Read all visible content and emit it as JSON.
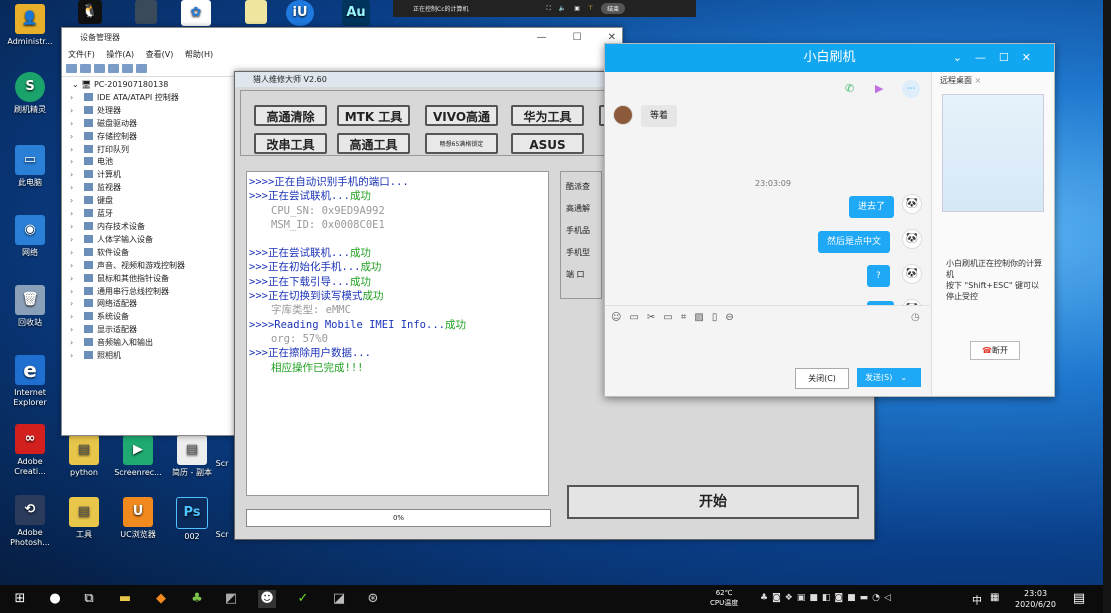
{
  "remote_bar": {
    "title": "正在控制Cc的计算机",
    "end_label": "结束"
  },
  "desktop_icons": [
    {
      "label": "Administr...",
      "color": "#e8b02a",
      "glyph": "👤"
    },
    {
      "label": "刷机精灵",
      "color": "#1aa36b",
      "glyph": "S"
    },
    {
      "label": "此电脑",
      "color": "#2a7fd6",
      "glyph": "▭"
    },
    {
      "label": "网络",
      "color": "#2a7fd6",
      "glyph": "◉"
    },
    {
      "label": "回收站",
      "color": "#8aa0b8",
      "glyph": "🗑"
    },
    {
      "label": "Internet Explorer",
      "color": "#1f6fd1",
      "glyph": "e"
    },
    {
      "label": "Adobe Creati...",
      "color": "#d3201f",
      "glyph": "∞"
    },
    {
      "label": "Adobe Photosh...",
      "color": "#2b3b5c",
      "glyph": "⟲"
    },
    {
      "label": "python",
      "color": "#e8c64a",
      "glyph": "▤"
    },
    {
      "label": "Screenrec...",
      "color": "#1eaa70",
      "glyph": "▶"
    },
    {
      "label": "简历 - 副本",
      "color": "#eeeeee",
      "glyph": "▤"
    },
    {
      "label": "工具",
      "color": "#e8c64a",
      "glyph": "▤"
    },
    {
      "label": "UC浏览器",
      "color": "#f08a1e",
      "glyph": "U"
    },
    {
      "label": "002",
      "color": "#0a2b5c",
      "glyph": "Ps"
    },
    {
      "label": "Scr",
      "color": "#444",
      "glyph": ""
    },
    {
      "label": "Scr",
      "color": "#444",
      "glyph": ""
    }
  ],
  "top_icons": [
    {
      "glyph": "Au",
      "color": "#00355e"
    },
    {
      "glyph": "iU",
      "color": "#1f7ae0"
    }
  ],
  "device_manager": {
    "title": "设备管理器",
    "menu": [
      "文件(F)",
      "操作(A)",
      "查看(V)",
      "帮助(H)"
    ],
    "root": "PC-201907180138",
    "items": [
      "IDE ATA/ATAPI 控制器",
      "处理器",
      "磁盘驱动器",
      "存储控制器",
      "打印队列",
      "电池",
      "计算机",
      "监视器",
      "键盘",
      "蓝牙",
      "内存技术设备",
      "人体学输入设备",
      "软件设备",
      "声音、视频和游戏控制器",
      "鼠标和其他指针设备",
      "通用串行总线控制器",
      "网络适配器",
      "系统设备",
      "显示适配器",
      "音频输入和输出",
      "照相机"
    ]
  },
  "repair_tool": {
    "title": "猎人维修大师 V2.60",
    "buttons": [
      "高通清除",
      "MTK 工具",
      "VIVO高通",
      "华为工具",
      "改串工具",
      "高通工具",
      "畅想65满格锁定",
      "ASUS"
    ],
    "log": [
      {
        "text": ">>>>正在自动识别手机的端口...",
        "style": "b"
      },
      {
        "text": ">>>正在尝试联机...",
        "style": "b",
        "extra": "成功"
      },
      {
        "text": "CPU_SN:  0x9ED9A992",
        "style": "gr"
      },
      {
        "text": "MSM_ID:  0x0008C0E1",
        "style": "gr"
      },
      {
        "text": "",
        "style": "b"
      },
      {
        "text": ">>>正在尝试联机...",
        "style": "b",
        "extra": "成功"
      },
      {
        "text": ">>>正在初始化手机...",
        "style": "b",
        "extra": "成功"
      },
      {
        "text": ">>>正在下载引导...",
        "style": "b",
        "extra": "成功"
      },
      {
        "text": ">>>正在切换到读写模式",
        "style": "b",
        "extra": "成功"
      },
      {
        "text": "字库类型:  eMMC",
        "style": "gr"
      },
      {
        "text": ">>>>Reading Mobile IMEI Info...",
        "style": "b",
        "extra": "成功"
      },
      {
        "text": "org: 57%0",
        "style": "gr"
      },
      {
        "text": ">>>正在擦除用户数据...",
        "style": "b"
      },
      {
        "text": "相应操作已完成!!!",
        "style": "g"
      }
    ],
    "progress": "0%",
    "side": [
      "酷派查",
      "高通解",
      "手机品",
      "手机型",
      "端 口"
    ],
    "start_label": "开始"
  },
  "chat": {
    "title": "小白刷机",
    "messages": [
      {
        "text": "等着",
        "side": "l"
      },
      {
        "text": "23:03:09",
        "side": "time"
      },
      {
        "text": "进去了",
        "side": "r"
      },
      {
        "text": "然后是点中文",
        "side": "r"
      },
      {
        "text": "?",
        "side": "r"
      },
      {
        "text": "对",
        "side": "r"
      }
    ],
    "close_label": "关闭(C)",
    "send_label": "发送(S)",
    "remote_tab": "远程桌面",
    "remote_msg": "小白刷机正在控制你的计算机\n按下 \"Shift+ESC\" 键可以停止受控",
    "disconnect_label": "断开"
  },
  "taskbar": {
    "temp": "62℃",
    "temp_label": "CPU温度",
    "time": "23:03",
    "date": "2020/6/20",
    "ime": "中"
  }
}
